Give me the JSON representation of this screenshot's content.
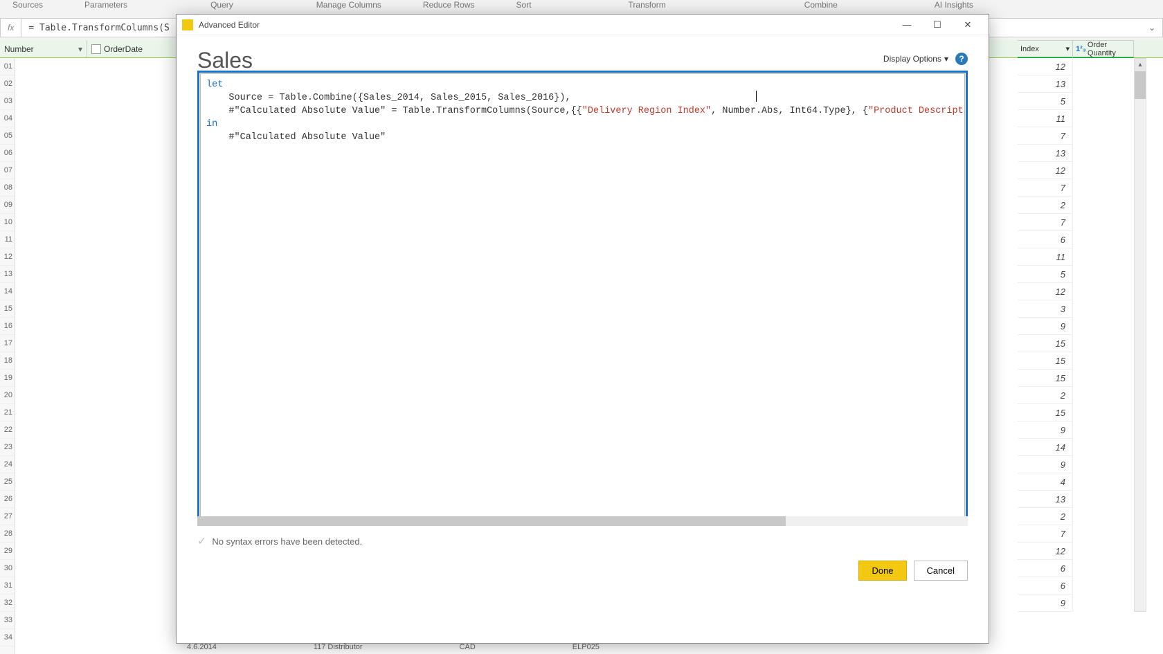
{
  "ribbon_groups": [
    "Sources",
    "Parameters",
    "Query",
    "Manage Columns",
    "Reduce Rows",
    "Sort",
    "Transform",
    "Combine",
    "AI Insights"
  ],
  "formula_bar": {
    "fx_label": "fx",
    "text": "= Table.TransformColumns(S"
  },
  "grid": {
    "left_header": "Number",
    "date_header": "OrderDate",
    "row_start": 1,
    "row_end": 34,
    "index_col": {
      "label": "Index",
      "values": [
        12,
        13,
        5,
        11,
        7,
        13,
        12,
        7,
        2,
        7,
        6,
        11,
        5,
        12,
        3,
        9,
        15,
        15,
        15,
        2,
        15,
        9,
        14,
        9,
        4,
        13,
        2,
        7,
        12,
        6,
        6,
        9
      ]
    },
    "qty_col": {
      "label": "Order Quantity",
      "type_prefix": "1²₃"
    }
  },
  "dialog": {
    "window_title": "Advanced Editor",
    "heading": "Sales",
    "display_options_label": "Display Options",
    "code": {
      "line1_kw": "let",
      "line2_pre": "    Source = Table.Combine({Sales_2014, Sales_2015, Sales_2016}),",
      "line3_pre": "    #\"Calculated Absolute Value\" = Table.TransformColumns(Source,{{",
      "line3_str1": "\"Delivery Region Index\"",
      "line3_mid": ", Number.Abs, Int64.Type}, {",
      "line3_str2": "\"Product Description In",
      "line4_kw": "in",
      "line5": "    #\"Calculated Absolute Value\""
    },
    "status_text": "No syntax errors have been detected.",
    "done_label": "Done",
    "cancel_label": "Cancel"
  },
  "bottom_row": [
    "4.6.2014",
    "117 Distributor",
    "CAD",
    "ELP025"
  ]
}
